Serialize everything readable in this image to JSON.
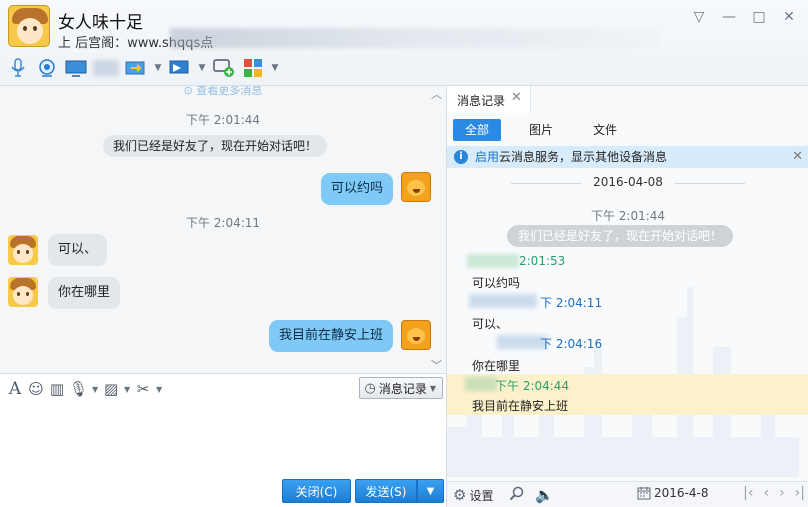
{
  "window": {
    "contact_name": "女人味十足",
    "signature": "上  后宫阁：www.shqqs点",
    "controls": {
      "menu": "▽",
      "minimize": "—",
      "maximize": "□",
      "close": "✕"
    }
  },
  "toolbar": {
    "icons": [
      "microphone-icon",
      "camera-icon",
      "screen-share-icon",
      "file-transfer-icon",
      "remote-assist-icon",
      "add-friend-icon",
      "apps-icon"
    ]
  },
  "chat": {
    "more_messages": "查看更多消息",
    "messages": [
      {
        "kind": "time",
        "text": "下午 2:01:44"
      },
      {
        "kind": "system",
        "text": "我们已经是好友了，现在开始对话吧！"
      },
      {
        "kind": "self",
        "text": "可以约吗"
      },
      {
        "kind": "time",
        "text": "下午 2:04:11"
      },
      {
        "kind": "other",
        "text": "可以、"
      },
      {
        "kind": "other",
        "text": "你在哪里"
      },
      {
        "kind": "self",
        "text": "我目前在静安上班"
      }
    ]
  },
  "input": {
    "history_button": "消息记录",
    "close_button": "关闭(C)",
    "send_button": "发送(S)",
    "send_dropdown": "▼"
  },
  "history": {
    "tab_label": "消息记录",
    "filter_tabs": [
      "全部",
      "图片",
      "文件"
    ],
    "active_filter": "全部",
    "cloud_notice": {
      "link": "启用",
      "text": "云消息服务，显示其他设备消息"
    },
    "date": "2016-04-08",
    "entries": {
      "time1": "下午 2:01:44",
      "system": "我们已经是好友了，现在开始对话吧！",
      "m1_time": "2:01:53",
      "m1_text": "可以约吗",
      "m2_time": "下 2:04:11",
      "m2_text": "可以、",
      "m3_time": "下 2:04:16",
      "m3_text": "你在哪里",
      "m4_time": "下午 2:04:44",
      "m4_text": "我目前在静安上班"
    },
    "footer": {
      "settings": "设置",
      "date": "2016-4-8"
    }
  },
  "colors": {
    "accent": "#2b8ae3",
    "self_bubble": "#7fc9f7",
    "highlight": "#fdf1cc"
  }
}
